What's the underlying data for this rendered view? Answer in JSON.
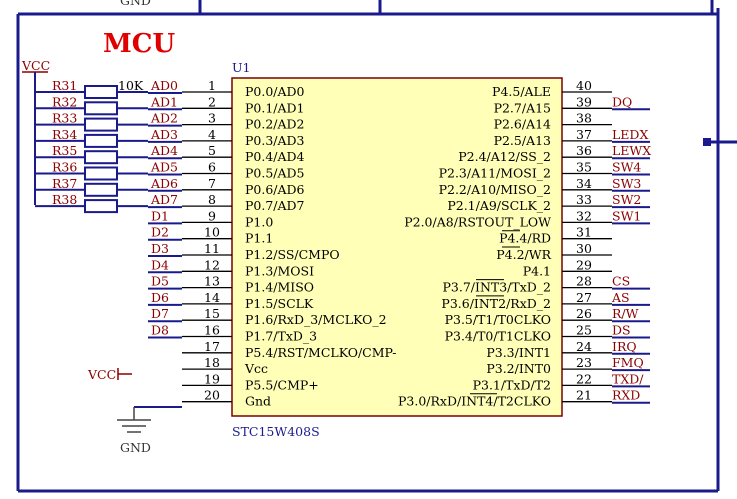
{
  "labels": {
    "title": "MCU",
    "designator": "U1",
    "part": "STC15W408S",
    "top_gnd": "GND",
    "vcc_top": "VCC",
    "vcc_pin": "VCC",
    "gnd": "GND",
    "resistor_value": "10K"
  },
  "left_pins": [
    {
      "num": "1",
      "name": "P0.0/AD0",
      "net": "AD0"
    },
    {
      "num": "2",
      "name": "P0.1/AD1",
      "net": "AD1"
    },
    {
      "num": "3",
      "name": "P0.2/AD2",
      "net": "AD2"
    },
    {
      "num": "4",
      "name": "P0.3/AD3",
      "net": "AD3"
    },
    {
      "num": "5",
      "name": "P0.4/AD4",
      "net": "AD4"
    },
    {
      "num": "6",
      "name": "P0.5/AD5",
      "net": "AD5"
    },
    {
      "num": "7",
      "name": "P0.6/AD6",
      "net": "AD6"
    },
    {
      "num": "8",
      "name": "P0.7/AD7",
      "net": "AD7"
    },
    {
      "num": "9",
      "name": "P1.0",
      "net": "D1"
    },
    {
      "num": "10",
      "name": "P1.1",
      "net": "D2"
    },
    {
      "num": "11",
      "name": "P1.2/SS/CMPO",
      "net": "D3"
    },
    {
      "num": "12",
      "name": "P1.3/MOSI",
      "net": "D4"
    },
    {
      "num": "13",
      "name": "P1.4/MISO",
      "net": "D5"
    },
    {
      "num": "14",
      "name": "P1.5/SCLK",
      "net": "D6"
    },
    {
      "num": "15",
      "name": "P1.6/RxD_3/MCLKO_2",
      "net": "D7"
    },
    {
      "num": "16",
      "name": "P1.7/TxD_3",
      "net": "D8"
    },
    {
      "num": "17",
      "name": "P5.4/RST/MCLKO/CMP-",
      "net": ""
    },
    {
      "num": "18",
      "name": "Vcc",
      "net": ""
    },
    {
      "num": "19",
      "name": "P5.5/CMP+",
      "net": ""
    },
    {
      "num": "20",
      "name": "Gnd",
      "net": ""
    }
  ],
  "right_pins": [
    {
      "num": "40",
      "name": "P4.5/ALE",
      "net": ""
    },
    {
      "num": "39",
      "name": "P2.7/A15",
      "net": "DQ"
    },
    {
      "num": "38",
      "name": "P2.6/A14",
      "net": ""
    },
    {
      "num": "37",
      "name": "P2.5/A13",
      "net": "LEDX"
    },
    {
      "num": "36",
      "name": "P2.4/A12/SS_2",
      "net": "LEWX"
    },
    {
      "num": "35",
      "name": "P2.3/A11/MOSI_2",
      "net": "SW4"
    },
    {
      "num": "34",
      "name": "P2.2/A10/MISO_2",
      "net": "SW3"
    },
    {
      "num": "33",
      "name": "P2.1/A9/SCLK_2",
      "net": "SW2"
    },
    {
      "num": "32",
      "name": "P2.0/A8/RSTOUT_LOW",
      "net": "SW1"
    },
    {
      "num": "31",
      "name": "P4.4/RD",
      "net": ""
    },
    {
      "num": "30",
      "name": "P4.2/WR",
      "net": ""
    },
    {
      "num": "29",
      "name": "P4.1",
      "net": ""
    },
    {
      "num": "28",
      "name": "P3.7/INT3/TxD_2",
      "net": "CS"
    },
    {
      "num": "27",
      "name": "P3.6/INT2/RxD_2",
      "net": "AS"
    },
    {
      "num": "26",
      "name": "P3.5/T1/T0CLKO",
      "net": "R/W"
    },
    {
      "num": "25",
      "name": "P3.4/T0/T1CLKO",
      "net": "DS"
    },
    {
      "num": "24",
      "name": "P3.3/INT1",
      "net": "IRQ"
    },
    {
      "num": "23",
      "name": "P3.2/INT0",
      "net": "FMQ"
    },
    {
      "num": "22",
      "name": "P3.1/TxD/T2",
      "net": "TXD/"
    },
    {
      "num": "21",
      "name": "P3.0/RxD/INT4/T2CLKO",
      "net": "RXD"
    }
  ],
  "resistors": [
    "R31",
    "R32",
    "R33",
    "R34",
    "R35",
    "R36",
    "R37",
    "R38"
  ]
}
